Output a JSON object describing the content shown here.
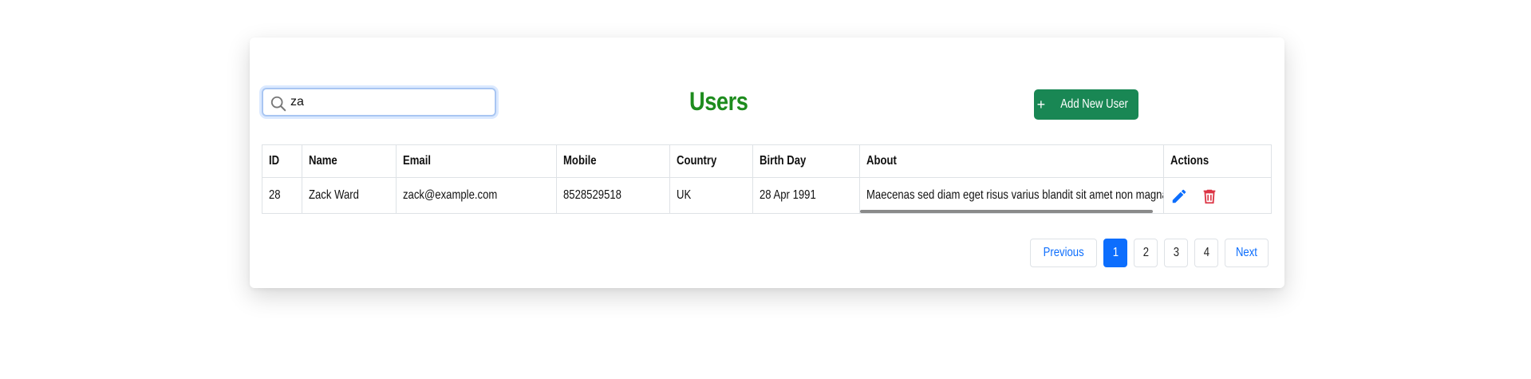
{
  "title": "Users",
  "search": {
    "value": "za",
    "icon": "search-icon"
  },
  "add_button": {
    "label": "Add New User",
    "icon": "plus-icon",
    "color": "#198754"
  },
  "table": {
    "columns": [
      "ID",
      "Name",
      "Email",
      "Mobile",
      "Country",
      "Birth Day",
      "About",
      "Actions"
    ],
    "rows": [
      {
        "id": "28",
        "name": "Zack Ward",
        "email": "zack@example.com",
        "mobile": "8528529518",
        "country": "UK",
        "birthday": "28 Apr 1991",
        "about": "Maecenas sed diam eget risus varius blandit sit amet non magna",
        "actions": [
          "edit-icon",
          "delete-icon"
        ]
      }
    ]
  },
  "pagination": {
    "previous": "Previous",
    "pages": [
      "1",
      "2",
      "3",
      "4"
    ],
    "active": "1",
    "next": "Next"
  },
  "colors": {
    "title": "#1e8c1e",
    "primary": "#0d6efd",
    "danger": "#dc3545"
  }
}
